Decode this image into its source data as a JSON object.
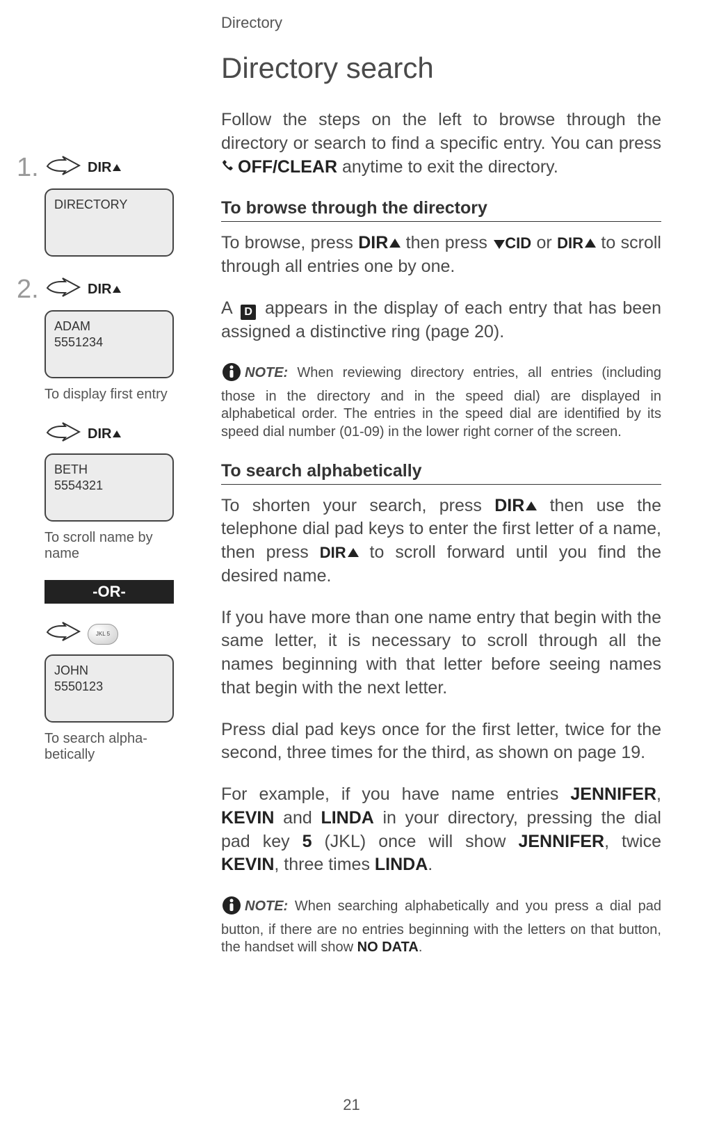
{
  "header": {
    "section": "Directory"
  },
  "title": "Directory search",
  "intro": "Follow the steps on the left to browse through the directory or search to find a specific entry. You can press ",
  "off_clear": "OFF/CLEAR",
  "intro_tail": " anytime to exit the directory.",
  "browse": {
    "heading": "To browse through the directory",
    "p1_a": "To browse, press ",
    "p1_b": " then press ",
    "p1_c": " or ",
    "p1_d": " to scroll through all entries one by one.",
    "dir_label": "DIR",
    "cid_label": "CID",
    "p2_a": "A ",
    "p2_b": " appears in the display of each entry that has been assigned a distinctive ring (page 20).",
    "d_glyph": "D"
  },
  "note1": {
    "label": "NOTE:",
    "text": " When reviewing directory entries, all entries (including those in the directory and in the speed dial) are displayed in alphabetical order. The entries in the speed dial are identified by its speed dial number (01-09) in the lower right corner of the screen."
  },
  "alpha": {
    "heading": "To search alphabetically",
    "p1_a": "To shorten your search, press ",
    "p1_b": " then use the telephone dial pad keys to enter the first letter of a name, then press ",
    "p1_c": " to scroll forward until you find the desired name.",
    "p2": "If you have more than one name entry that begin with the same letter, it is necessary to scroll through all the names beginning with that letter before seeing names that begin with the next letter.",
    "p3": "Press dial pad keys once for the first letter, twice for the second, three times for the third, as shown on page 19.",
    "p4_a": "For example, if you have name entries ",
    "p4_jennifer": "JENNIFER",
    "p4_b": ", ",
    "p4_kevin": "KEVIN",
    "p4_c": " and ",
    "p4_linda": "LINDA",
    "p4_d": " in your directory, pressing the dial pad key ",
    "p4_key": "5",
    "p4_e": " (JKL) once will show ",
    "p4_f": ", twice ",
    "p4_g": ", three times ",
    "p4_h": "."
  },
  "note2": {
    "label": "NOTE:",
    "text_a": " When searching alphabetically and you press a dial pad button, if there are no entries beginning with the letters on that button, the handset will show ",
    "nodata": "NO DATA",
    "text_b": "."
  },
  "left": {
    "dir_label": "DIR",
    "step1_screen": "DIRECTORY",
    "step2_name": "ADAM",
    "step2_num": "5551234",
    "step2_caption": "To display first entry",
    "step3_name": "BETH",
    "step3_num": "5554321",
    "step3_caption": "To scroll name by name",
    "or": "-OR-",
    "key5": "JKL 5",
    "step4_name": "JOHN",
    "step4_num": "5550123",
    "step4_caption": "To search alpha-\nbetically"
  },
  "page_number": "21",
  "nums": {
    "one": "1.",
    "two": "2."
  }
}
